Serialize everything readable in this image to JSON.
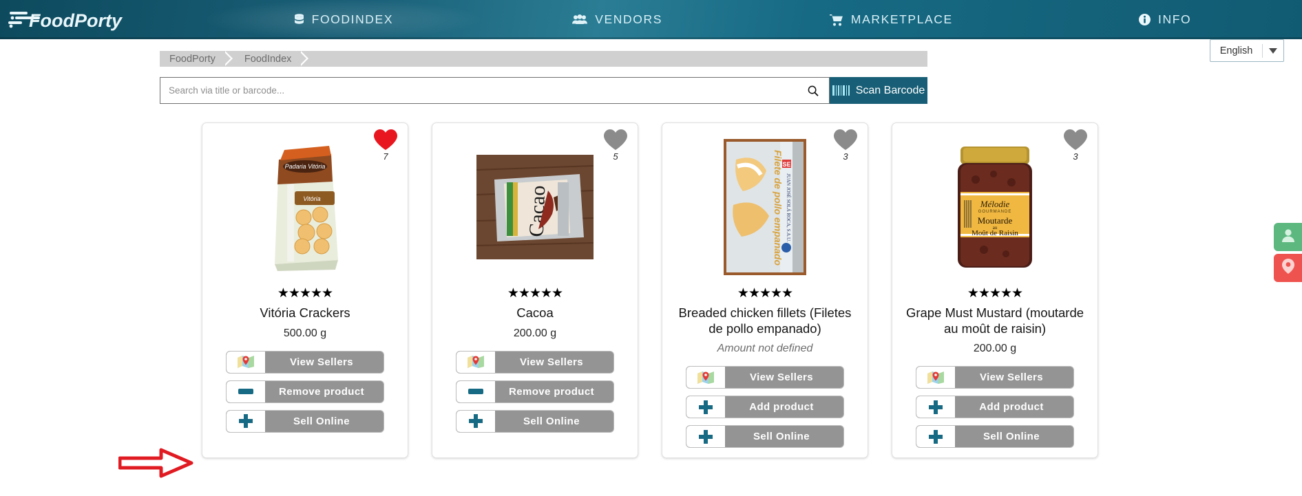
{
  "brand": {
    "name": "FoodPorty"
  },
  "navbar": {
    "items": [
      {
        "label": "FOODINDEX",
        "icon": "database-icon",
        "active": true
      },
      {
        "label": "VENDORS",
        "icon": "users-icon",
        "active": false
      },
      {
        "label": "MARKETPLACE",
        "icon": "shopping-cart-icon",
        "active": false
      },
      {
        "label": "INFO",
        "icon": "info-circle-icon",
        "active": false
      }
    ],
    "bg_color": "#176a84"
  },
  "language_select": {
    "value": "English",
    "caret_icon": "chevron-down-icon"
  },
  "breadcrumb": {
    "items": [
      "FoodPorty",
      "FoodIndex"
    ]
  },
  "search": {
    "placeholder": "Search via title or barcode...",
    "value": "",
    "icon": "search-icon",
    "scan_button": {
      "label": "Scan Barcode",
      "icon": "barcode-icon",
      "color": "#175e76"
    }
  },
  "products": [
    {
      "title": "Vitória Crackers",
      "amount": "500.00 g",
      "amount_defined": true,
      "rating": 5,
      "favorites": "7",
      "favorited": true,
      "heart_color": "#e8161f",
      "image_alt": "Padaria Vitória Vitoria Crackers package",
      "buttons": [
        {
          "label": "View Sellers",
          "icon": "map-pin-icon"
        },
        {
          "label": "Remove product",
          "icon": "minus-icon"
        },
        {
          "label": "Sell Online",
          "icon": "plus-icon"
        }
      ]
    },
    {
      "title": "Cacoa",
      "amount": "200.00 g",
      "amount_defined": true,
      "rating": 5,
      "favorites": "5",
      "favorited": false,
      "heart_color": "#8b8b8b",
      "image_alt": "Organic Cacao pouch on wooden table",
      "buttons": [
        {
          "label": "View Sellers",
          "icon": "map-pin-icon"
        },
        {
          "label": "Remove product",
          "icon": "minus-icon"
        },
        {
          "label": "Sell Online",
          "icon": "plus-icon"
        }
      ]
    },
    {
      "title": "Breaded chicken fillets (Filetes de pollo empanado)",
      "amount": "Amount not defined",
      "amount_defined": false,
      "rating": 5,
      "favorites": "3",
      "favorited": false,
      "heart_color": "#8b8b8b",
      "image_alt": "Filete de pollo empanado box",
      "buttons": [
        {
          "label": "View Sellers",
          "icon": "map-pin-icon"
        },
        {
          "label": "Add product",
          "icon": "plus-icon"
        },
        {
          "label": "Sell Online",
          "icon": "plus-icon"
        }
      ]
    },
    {
      "title": "Grape Must Mustard (moutarde au moût de raisin)",
      "amount": "200.00 g",
      "amount_defined": true,
      "rating": 5,
      "favorites": "3",
      "favorited": false,
      "heart_color": "#8b8b8b",
      "image_alt": "Mélodie Gourmande Moutarde au Moût de Raisin jar",
      "buttons": [
        {
          "label": "View Sellers",
          "icon": "map-pin-icon"
        },
        {
          "label": "Add product",
          "icon": "plus-icon"
        },
        {
          "label": "Sell Online",
          "icon": "plus-icon"
        }
      ]
    }
  ],
  "side_fabs": [
    {
      "name": "account-fab",
      "icon": "user-icon",
      "color": "#5cb87f"
    },
    {
      "name": "location-fab",
      "icon": "map-pin-icon",
      "color": "#ef5350"
    }
  ],
  "annotation": {
    "type": "red-arrow",
    "points_to": "Sell Online",
    "color": "#e01b22"
  }
}
